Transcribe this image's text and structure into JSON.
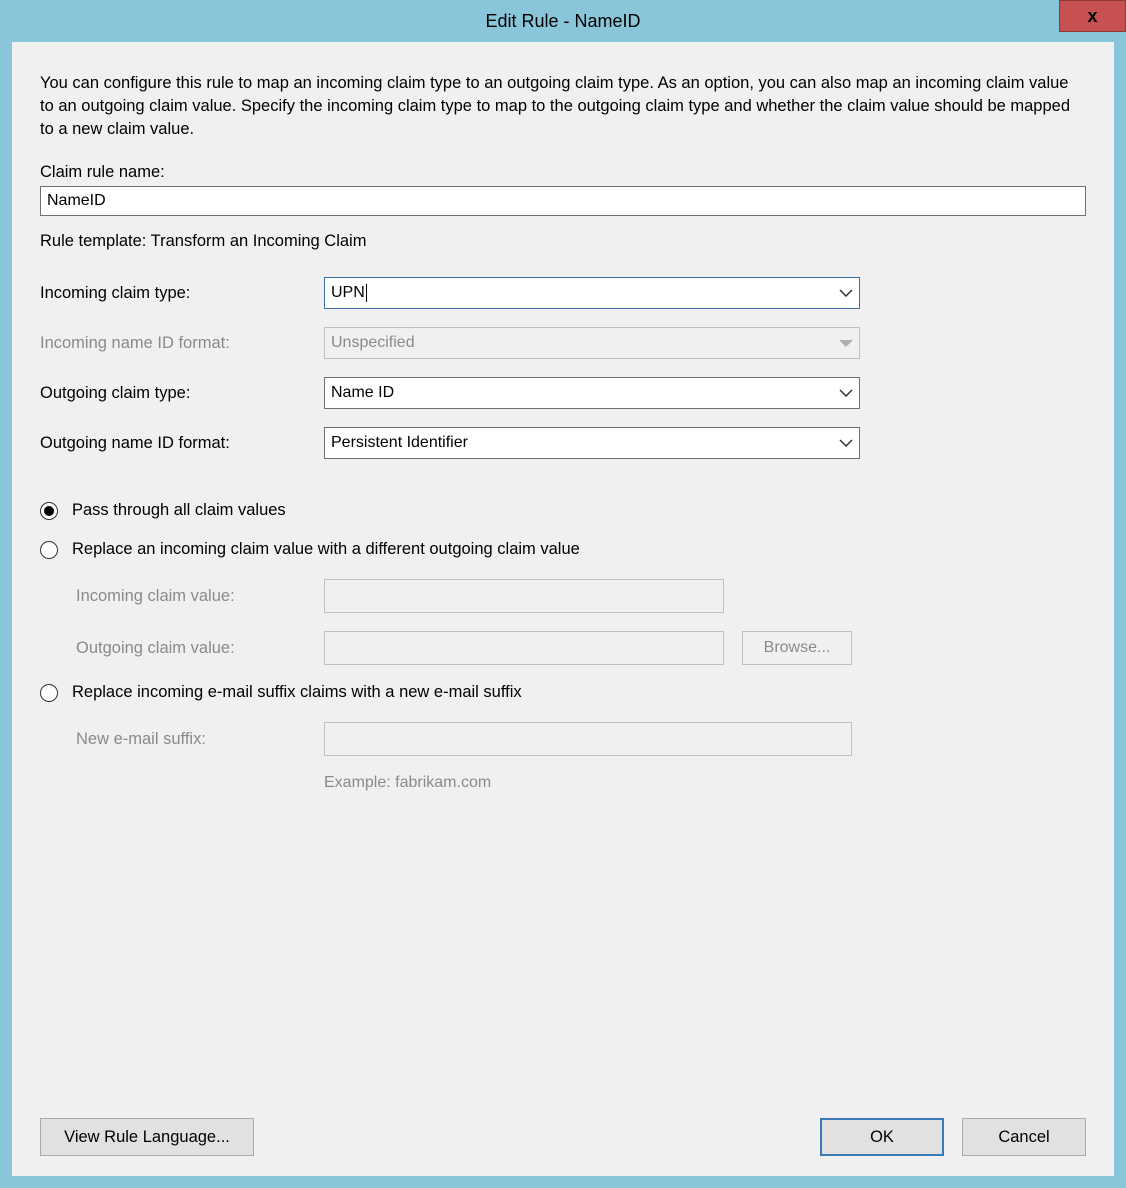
{
  "titlebar": {
    "title": "Edit Rule - NameID",
    "close_icon": "x"
  },
  "description": "You can configure this rule to map an incoming claim type to an outgoing claim type. As an option, you can also map an incoming claim value to an outgoing claim value. Specify the incoming claim type to map to the outgoing claim type and whether the claim value should be mapped to a new claim value.",
  "claim_rule_name_label": "Claim rule name:",
  "claim_rule_name_value": "NameID",
  "rule_template_label": "Rule template: Transform an Incoming Claim",
  "fields": {
    "incoming_claim_type": {
      "label": "Incoming claim type:",
      "value": "UPN"
    },
    "incoming_name_id_format": {
      "label": "Incoming name ID format:",
      "value": "Unspecified"
    },
    "outgoing_claim_type": {
      "label": "Outgoing claim type:",
      "value": "Name ID"
    },
    "outgoing_name_id_format": {
      "label": "Outgoing name ID format:",
      "value": "Persistent Identifier"
    }
  },
  "radios": {
    "pass_through": "Pass through all claim values",
    "replace_value": "Replace an incoming claim value with a different outgoing claim value",
    "replace_suffix": "Replace incoming e-mail suffix claims with a new e-mail suffix"
  },
  "sub_labels": {
    "incoming_claim_value": "Incoming claim value:",
    "outgoing_claim_value": "Outgoing claim value:",
    "new_email_suffix": "New e-mail suffix:",
    "example": "Example: fabrikam.com",
    "browse": "Browse..."
  },
  "buttons": {
    "view_rule_language": "View Rule Language...",
    "ok": "OK",
    "cancel": "Cancel"
  }
}
